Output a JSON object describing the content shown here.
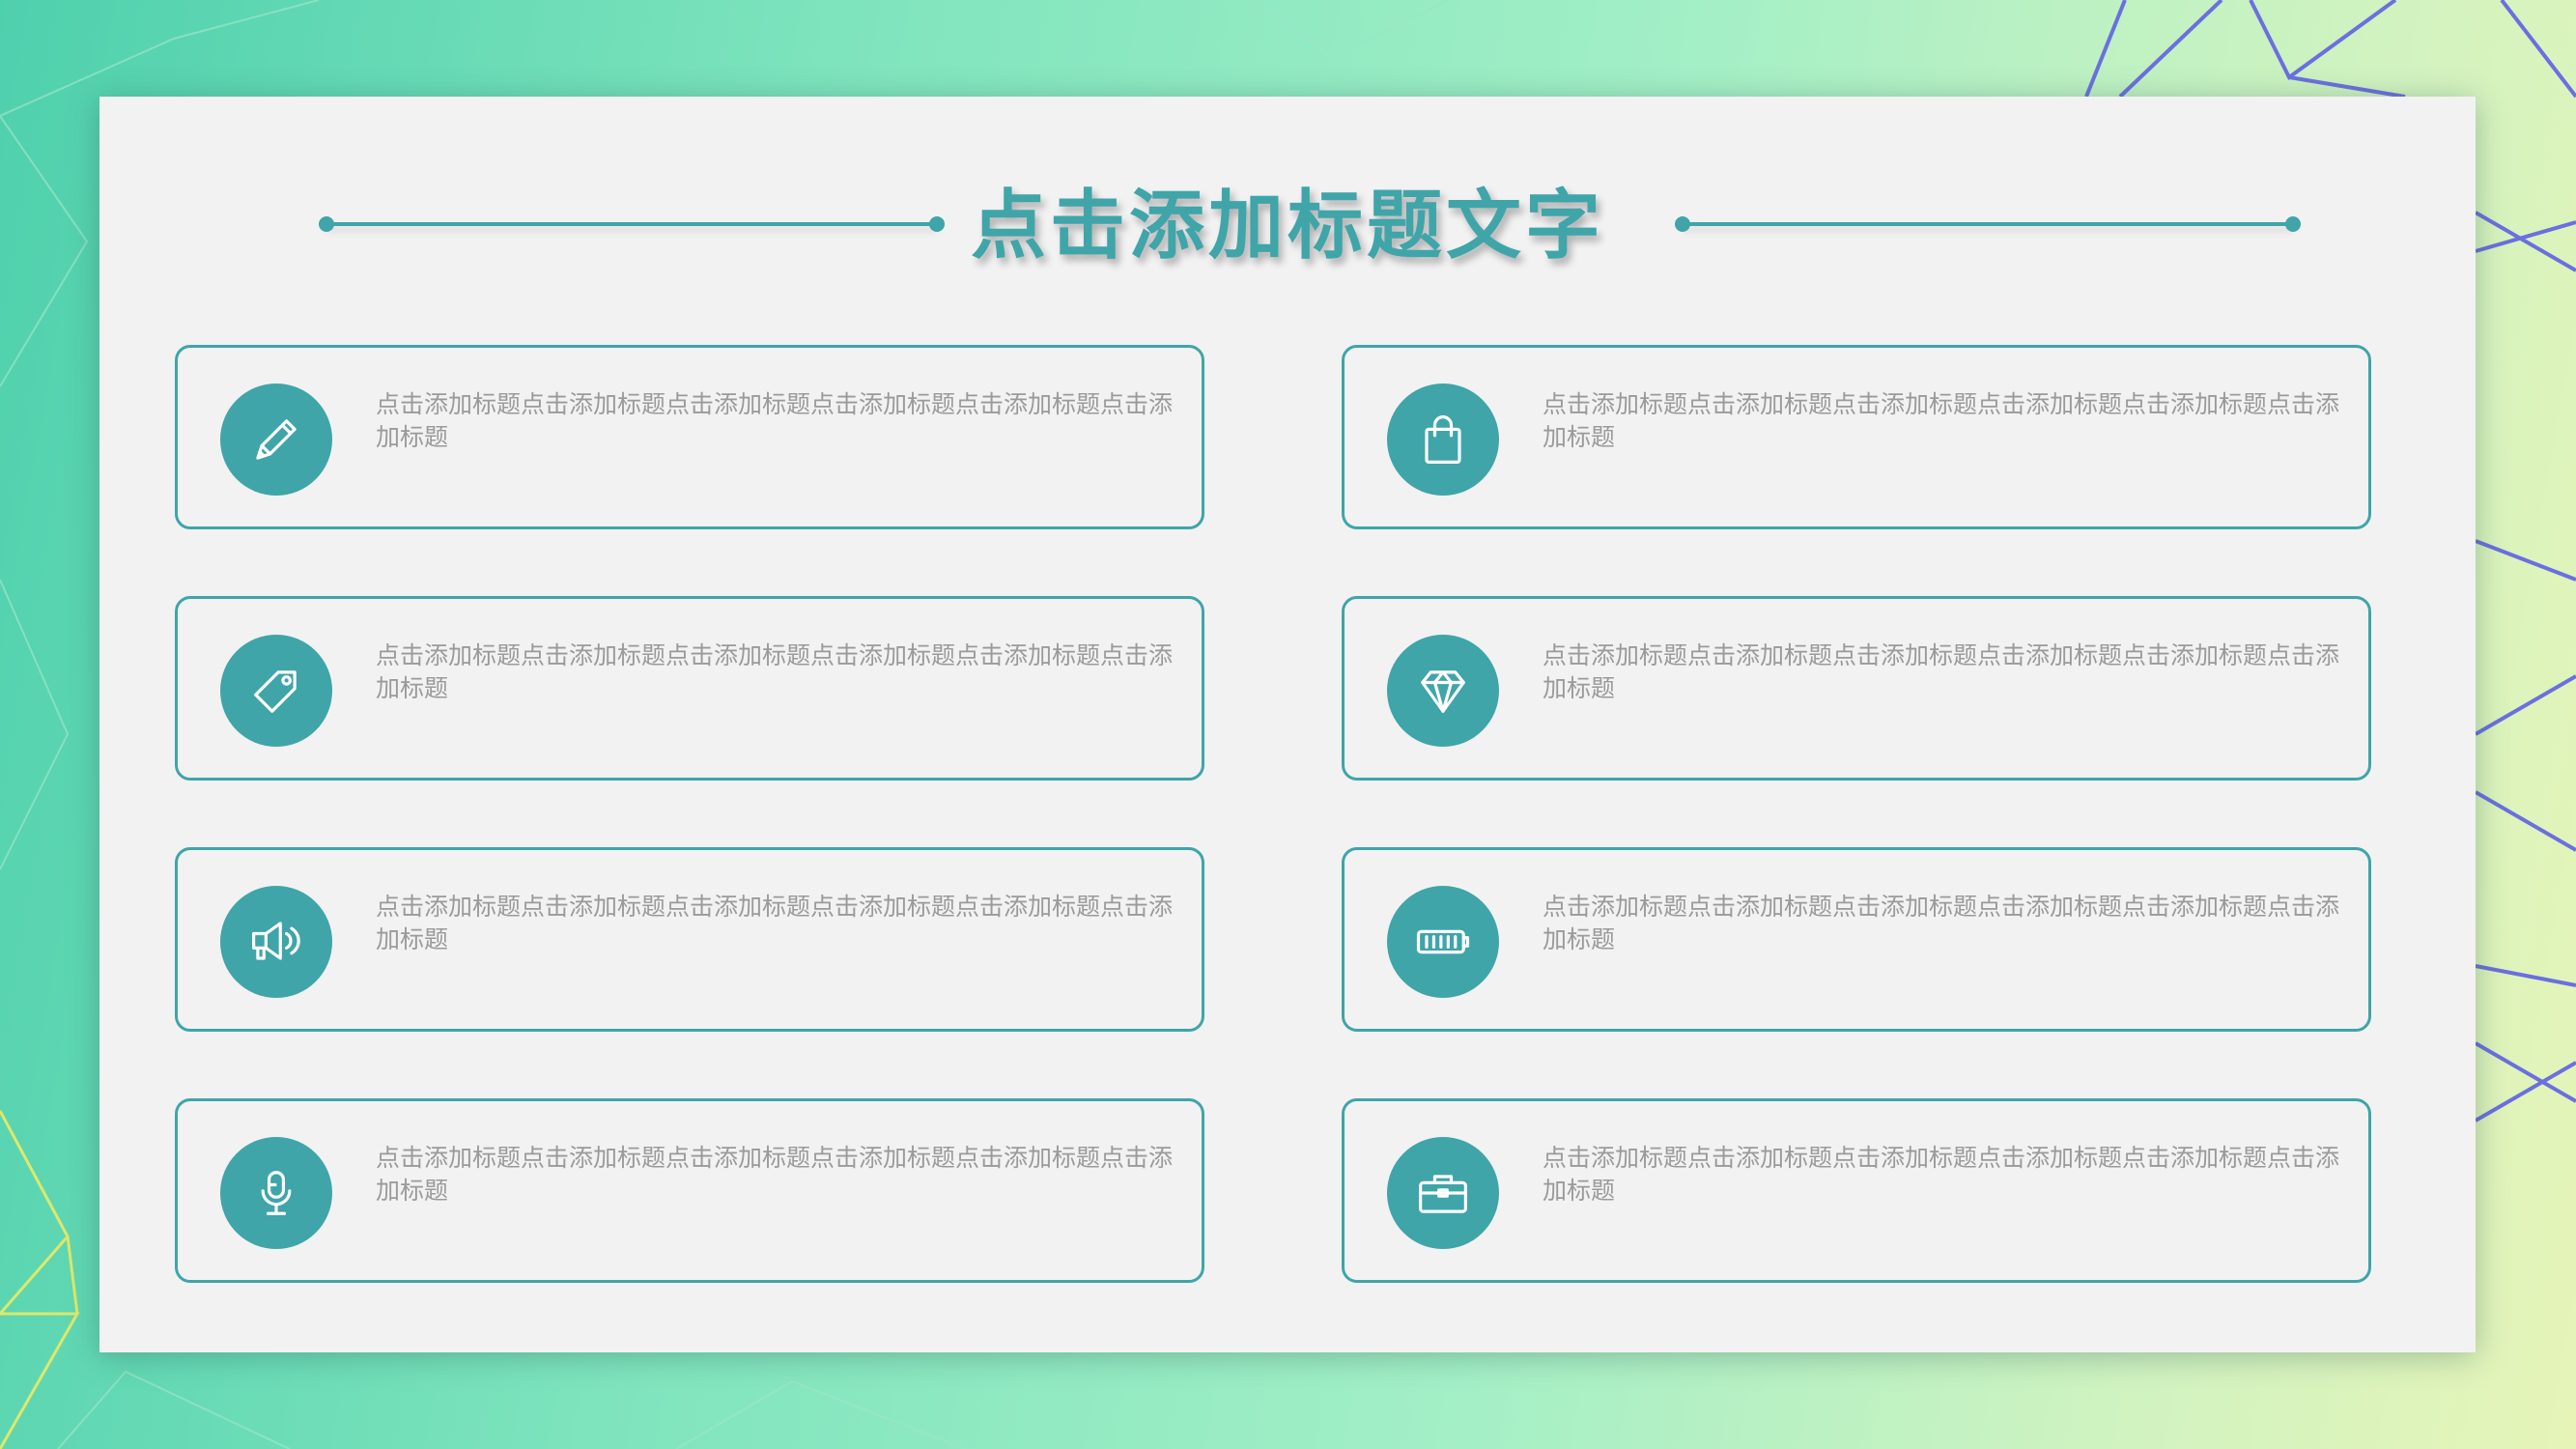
{
  "title": "点击添加标题文字",
  "colors": {
    "accent": "#3fa5a9",
    "panel": "#f2f2f2",
    "text_muted": "#9a9a9a"
  },
  "cards": [
    {
      "icon": "pencil-icon",
      "text": "点击添加标题点击添加标题点击添加标题点击添加标题点击添加标题点击添加标题"
    },
    {
      "icon": "shopping-bag-icon",
      "text": "点击添加标题点击添加标题点击添加标题点击添加标题点击添加标题点击添加标题"
    },
    {
      "icon": "tag-icon",
      "text": "点击添加标题点击添加标题点击添加标题点击添加标题点击添加标题点击添加标题"
    },
    {
      "icon": "diamond-icon",
      "text": "点击添加标题点击添加标题点击添加标题点击添加标题点击添加标题点击添加标题"
    },
    {
      "icon": "megaphone-icon",
      "text": "点击添加标题点击添加标题点击添加标题点击添加标题点击添加标题点击添加标题"
    },
    {
      "icon": "battery-icon",
      "text": "点击添加标题点击添加标题点击添加标题点击添加标题点击添加标题点击添加标题"
    },
    {
      "icon": "microphone-icon",
      "text": "点击添加标题点击添加标题点击添加标题点击添加标题点击添加标题点击添加标题"
    },
    {
      "icon": "briefcase-icon",
      "text": "点击添加标题点击添加标题点击添加标题点击添加标题点击添加标题点击添加标题"
    }
  ]
}
